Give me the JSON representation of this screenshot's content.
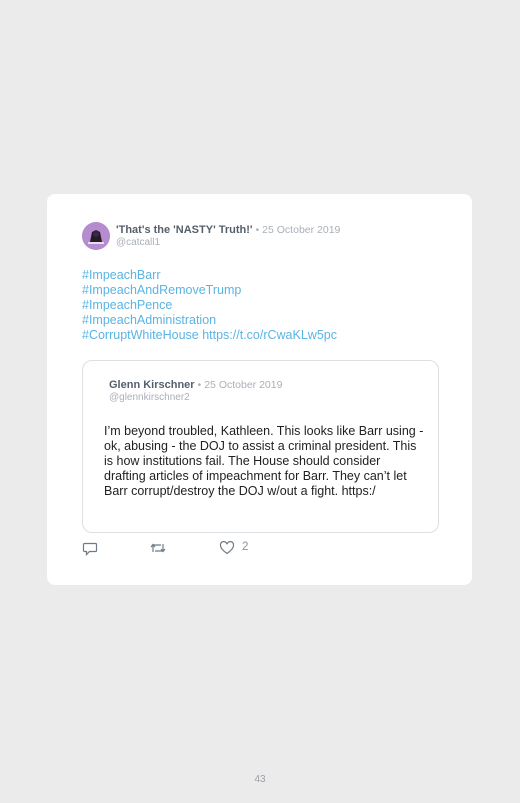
{
  "tweet": {
    "author_name": "'That's the 'NASTY' Truth!'",
    "separator": "•",
    "date": "25 October 2019",
    "handle": "@catcall1",
    "hashtags": [
      "#ImpeachBarr",
      "#ImpeachAndRemoveTrump",
      "#ImpeachPence",
      "#ImpeachAdministration"
    ],
    "last_tag": "#CorruptWhiteHouse",
    "link": "https://t.co/rCwaKLw5pc",
    "like_count": "2"
  },
  "quoted": {
    "author_name": "Glenn Kirschner",
    "separator": "•",
    "date": "25 October 2019",
    "handle": "@glennkirschner2",
    "text": "I’m beyond troubled, Kathleen. This looks like Barr using - ok, abusing - the DOJ to assist a criminal president. This is how institutions fail. The House should consider drafting articles of impeachment for Barr. They can’t let Barr corrupt/destroy the DOJ w/out a fight. https:/"
  },
  "page": {
    "number": "43"
  },
  "colors": {
    "background": "#ebebeb",
    "link": "#5ab4e4",
    "muted": "#aab0b8"
  },
  "icons": [
    "reply-icon",
    "retweet-icon",
    "like-icon"
  ]
}
